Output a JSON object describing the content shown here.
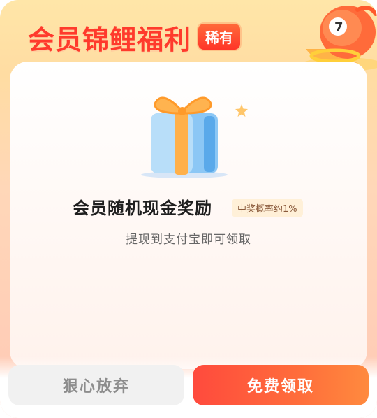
{
  "header": {
    "title": "会员锦鲤福利",
    "rare_badge": "稀有",
    "mascot_icon": "koi-mascot-icon"
  },
  "card": {
    "gift_icon": "gift-box-icon",
    "star_icon": "star-sparkle-icon",
    "reward_title": "会员随机现金奖励",
    "probability_badge": "中奖概率约1%",
    "subtitle": "提现到支付宝即可领取"
  },
  "buttons": {
    "give_up_label": "狠心放弃",
    "claim_label": "免费领取"
  },
  "colors": {
    "title_red": "#ff3a2c",
    "claim_gradient_start": "#ff4a3d",
    "claim_gradient_end": "#ff8a3e",
    "give_up_bg": "#f1f1f1"
  }
}
